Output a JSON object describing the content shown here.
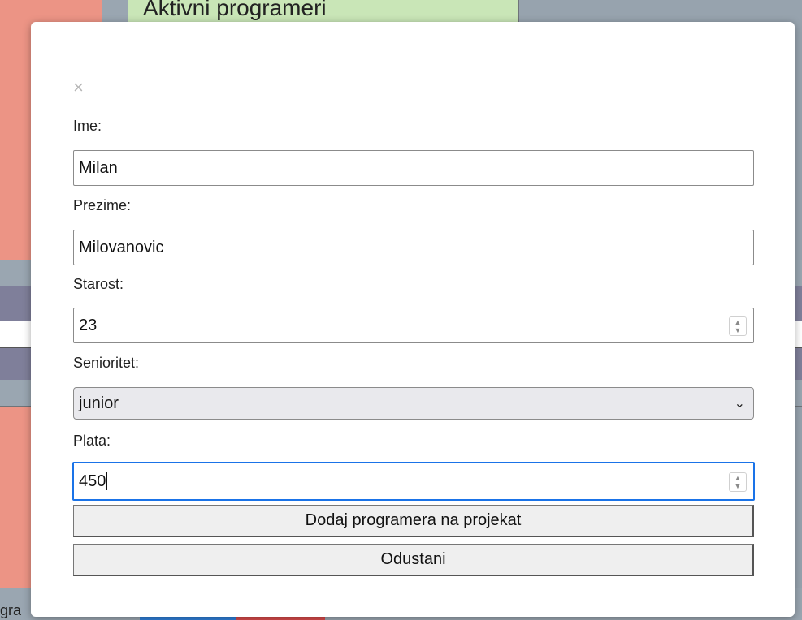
{
  "background": {
    "header_title": "Aktivni programeri",
    "bottom_left_fragment": "gra"
  },
  "modal": {
    "close_symbol": "×",
    "fields": {
      "first_name": {
        "label": "Ime:",
        "value": "Milan"
      },
      "last_name": {
        "label": "Prezime:",
        "value": "Milovanovic"
      },
      "age": {
        "label": "Starost:",
        "value": "23"
      },
      "seniority": {
        "label": "Senioritet:",
        "value": "junior"
      },
      "salary": {
        "label": "Plata:",
        "value": "450"
      }
    },
    "buttons": {
      "add": "Dodaj programera na projekat",
      "cancel": "Odustani"
    }
  },
  "colors": {
    "focus": "#1a73e8",
    "bg_salmon": "#ec9485",
    "bg_green": "#c9e6b7",
    "bg_slate": "#9aa6b1"
  }
}
